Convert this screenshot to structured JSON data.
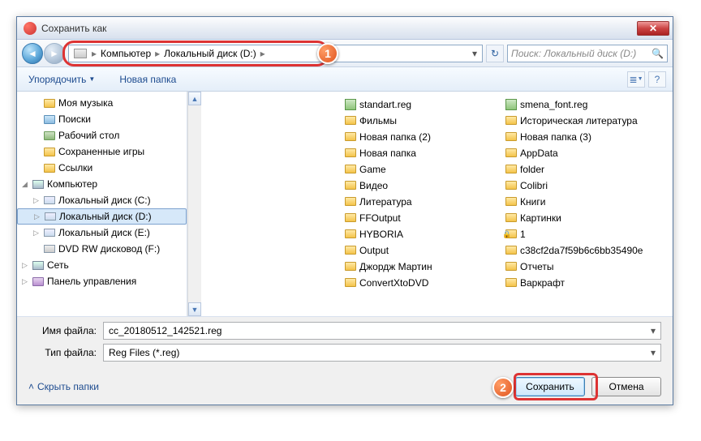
{
  "titlebar": {
    "title": "Сохранить как"
  },
  "breadcrumb": {
    "item1": "Компьютер",
    "item2": "Локальный диск (D:)"
  },
  "search": {
    "placeholder": "Поиск: Локальный диск (D:)"
  },
  "toolbar": {
    "organize": "Упорядочить",
    "newfolder": "Новая папка"
  },
  "tree": {
    "mymusic": "Моя музыка",
    "searches": "Поиски",
    "desktop": "Рабочий стол",
    "savedgames": "Сохраненные игры",
    "links": "Ссылки",
    "computer": "Компьютер",
    "diskC": "Локальный диск (C:)",
    "diskD": "Локальный диск (D:)",
    "diskE": "Локальный диск (E:)",
    "dvd": "DVD RW дисковод (F:)",
    "network": "Сеть",
    "control": "Панель управления"
  },
  "files_left": [
    {
      "name": "standart.reg",
      "type": "reg"
    },
    {
      "name": "Фильмы",
      "type": "folder"
    },
    {
      "name": "Новая папка (2)",
      "type": "folder"
    },
    {
      "name": "Новая папка",
      "type": "folder"
    },
    {
      "name": "Game",
      "type": "folder"
    },
    {
      "name": "Видео",
      "type": "folder"
    },
    {
      "name": "Литература",
      "type": "folder"
    },
    {
      "name": "FFOutput",
      "type": "folder"
    },
    {
      "name": "HYBORIA",
      "type": "folder"
    },
    {
      "name": "Output",
      "type": "folder"
    },
    {
      "name": "Джордж Мартин",
      "type": "folder"
    },
    {
      "name": "ConvertXtoDVD",
      "type": "folder"
    }
  ],
  "files_right": [
    {
      "name": "smena_font.reg",
      "type": "reg"
    },
    {
      "name": "Историческая литература",
      "type": "folder"
    },
    {
      "name": "Новая папка (3)",
      "type": "folder"
    },
    {
      "name": "AppData",
      "type": "folder"
    },
    {
      "name": "folder",
      "type": "folder"
    },
    {
      "name": "Colibri",
      "type": "folder"
    },
    {
      "name": "Книги",
      "type": "folder"
    },
    {
      "name": "Картинки",
      "type": "folder"
    },
    {
      "name": "1",
      "type": "folder",
      "locked": true
    },
    {
      "name": "c38cf2da7f59b6c6bb35490e",
      "type": "folder"
    },
    {
      "name": "Отчеты",
      "type": "folder"
    },
    {
      "name": "Варкрафт",
      "type": "folder"
    }
  ],
  "filename_label": "Имя файла:",
  "filename_value": "cc_20180512_142521.reg",
  "filetype_label": "Тип файла:",
  "filetype_value": "Reg Files (*.reg)",
  "hide_folders": "Скрыть папки",
  "btn_save": "Сохранить",
  "btn_cancel": "Отмена",
  "markers": {
    "m1": "1",
    "m2": "2"
  }
}
